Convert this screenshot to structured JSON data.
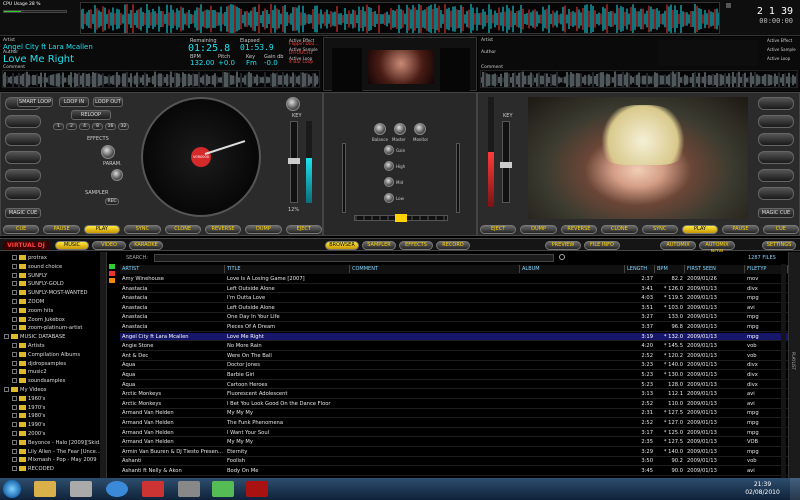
{
  "topbar": {
    "cpu_label": "CPU Usage",
    "cpu_value": "28 %",
    "clock_time": "2 1 39",
    "clock_counter": "00:00:00"
  },
  "deck_a": {
    "artist_label": "Artist",
    "artist": "Angel City ft Lara Mcallen",
    "author_label": "Author",
    "title": "Love Me Right",
    "comment_label": "Comment",
    "remaining_label": "Remaining",
    "remaining": "01:25.8",
    "elapsed_label": "Elapsed",
    "elapsed": "01:53.9",
    "bpm_label": "BPM",
    "bpm": "132.00",
    "pitch_label": "Pitch",
    "pitch": "+0.0",
    "key_label": "Key",
    "key": "Fm",
    "gain_label": "Gain db",
    "gain": "-0.0",
    "effect_label": "Active Effect",
    "effect": "Flippin Dou...",
    "sample_label": "Active Sample",
    "sample": "DITOUCH1",
    "loop_label": "Active Loop",
    "loop": "4 Bar Loop",
    "buttons": {
      "smart_loop": "SMART LOOP",
      "loop_in": "LOOP IN",
      "loop_out": "LOOP OUT",
      "reloop": "RELOOP",
      "effects": "EFFECTS",
      "param": "PARAM.",
      "sampler": "SAMPLER",
      "rec": "REC",
      "magic_cue": "MAGIC CUE",
      "key": "KEY",
      "pitch_pct": "12%"
    },
    "loop_sizes": [
      "1",
      "2",
      "4",
      "8",
      "16",
      "32"
    ],
    "transport": [
      "CUE",
      "PAUSE",
      "PLAY",
      "SYNC",
      "CLONE",
      "REVERSE",
      "DUMP",
      "EJECT"
    ],
    "platter_label": "V0R0000"
  },
  "deck_b": {
    "artist_label": "Artist",
    "author_label": "Author",
    "comment_label": "Comment",
    "effect_label": "Active Effect",
    "sample_label": "Active Sample",
    "loop_label": "Active Loop",
    "key_label": "KEY",
    "magic_cue": "MAGIC CUE",
    "transport": [
      "EJECT",
      "DUMP",
      "REVERSE",
      "CLONE",
      "SYNC",
      "PLAY",
      "PAUSE",
      "CUE"
    ]
  },
  "mixer": {
    "knobs": [
      "Balance",
      "Master",
      "Monitor"
    ],
    "eq": [
      "Gain",
      "High",
      "Mid",
      "Low"
    ]
  },
  "tabs": {
    "logo": "VIRTUAL DJ",
    "left": [
      "MUSIC",
      "VIDEO",
      "KARAOKE"
    ],
    "center": [
      "BROWSER",
      "SAMPLER",
      "EFFECTS",
      "RECORD"
    ],
    "right": [
      "PREVIEW",
      "FILE INFO"
    ],
    "far_right": [
      "AUTOMIX",
      "AUTOMIX NOW"
    ],
    "settings": "SETTINGS"
  },
  "search": {
    "label": "SEARCH:",
    "value": "",
    "files_count": "1287 FILES"
  },
  "sidebar": {
    "items": [
      {
        "label": "protrax",
        "indent": 1
      },
      {
        "label": "sound choice",
        "indent": 1
      },
      {
        "label": "SUNFLY",
        "indent": 1
      },
      {
        "label": "SUNFLY-GOLD",
        "indent": 1
      },
      {
        "label": "SUNFLY-MOST-WANTED",
        "indent": 1
      },
      {
        "label": "ZOOM",
        "indent": 1
      },
      {
        "label": "zoom hits",
        "indent": 1
      },
      {
        "label": "Zoom Jukebox",
        "indent": 1
      },
      {
        "label": "zoom-platinum-artist",
        "indent": 1
      },
      {
        "label": "MUSIC DATABASE",
        "indent": 0
      },
      {
        "label": "Artists",
        "indent": 1
      },
      {
        "label": "Compilation Albums",
        "indent": 1
      },
      {
        "label": "djdropsamples",
        "indent": 1
      },
      {
        "label": "music2",
        "indent": 1
      },
      {
        "label": "soundsamples",
        "indent": 1
      },
      {
        "label": "My Videos",
        "indent": 0
      },
      {
        "label": "1960's",
        "indent": 1
      },
      {
        "label": "1970's",
        "indent": 1
      },
      {
        "label": "1980's",
        "indent": 1
      },
      {
        "label": "1990's",
        "indent": 1
      },
      {
        "label": "2000's",
        "indent": 1
      },
      {
        "label": "Beyonce - Halo [2009][Skid...",
        "indent": 1
      },
      {
        "label": "Lily Allen - The Fear [Unce...",
        "indent": 1
      },
      {
        "label": "Mixmash - Pop - May 2009",
        "indent": 1
      },
      {
        "label": "RECODED",
        "indent": 1
      }
    ]
  },
  "table": {
    "columns": [
      "ARTIST",
      "TITLE",
      "COMMENT",
      "ALBUM",
      "LENGTH",
      "BPM",
      "FIRST SEEN",
      "FILETYP"
    ],
    "rows": [
      [
        "Amy Winehouse",
        "Love Is A Losing Game [2007]",
        "",
        "",
        "2:37",
        "82.2",
        "2009/01/26",
        "mov"
      ],
      [
        "Anastacia",
        "Left Outside Alone",
        "",
        "",
        "3:41",
        "* 126.0",
        "2009/01/13",
        "divx"
      ],
      [
        "Anastacia",
        "I'm Outta Love",
        "",
        "",
        "4:03",
        "* 119.5",
        "2009/01/13",
        "mpg"
      ],
      [
        "Anastacia",
        "Left Outside Alone",
        "",
        "",
        "3:51",
        "* 103.0",
        "2009/01/13",
        "avi"
      ],
      [
        "Anastacia",
        "One Day In Your Life",
        "",
        "",
        "3:27",
        "133.0",
        "2009/01/13",
        "mpg"
      ],
      [
        "Anastacia",
        "Pieces Of A Dream",
        "",
        "",
        "3:37",
        "96.8",
        "2009/01/13",
        "mpg"
      ],
      [
        "Angel City ft Lara Mcallen",
        "Love Me Right",
        "",
        "",
        "3:19",
        "* 132.0",
        "2009/01/13",
        "mpg"
      ],
      [
        "Angie Stone",
        "No More Rain",
        "",
        "",
        "4:20",
        "* 145.5",
        "2009/01/13",
        "vob"
      ],
      [
        "Ant & Dec",
        "Were On The Ball",
        "",
        "",
        "2:52",
        "* 120.2",
        "2009/01/13",
        "vob"
      ],
      [
        "Aqua",
        "Doctor Jones",
        "",
        "",
        "3:23",
        "* 140.0",
        "2009/01/13",
        "divx"
      ],
      [
        "Aqua",
        "Barbie Girl",
        "",
        "",
        "5:23",
        "* 130.0",
        "2009/01/13",
        "divx"
      ],
      [
        "Aqua",
        "Cartoon Heroes",
        "",
        "",
        "5:23",
        "128.0",
        "2009/01/13",
        "divx"
      ],
      [
        "Arctic Monkeys",
        "Fluorescent Adolescent",
        "",
        "",
        "3:13",
        "112.1",
        "2009/01/13",
        "avi"
      ],
      [
        "Arctic Monkeys",
        "I Bet You Look Good On the Dance Floor",
        "",
        "",
        "2:52",
        "110.0",
        "2009/01/13",
        "avi"
      ],
      [
        "Armand Van Helden",
        "My My My",
        "",
        "",
        "2:31",
        "* 127.5",
        "2009/01/13",
        "mpg"
      ],
      [
        "Armand Van Helden",
        "The Funk Phenomena",
        "",
        "",
        "2:52",
        "* 127.0",
        "2009/01/13",
        "mpg"
      ],
      [
        "Armand Van Helden",
        "I Want Your Soul",
        "",
        "",
        "3:17",
        "* 125.0",
        "2009/01/13",
        "mpg"
      ],
      [
        "Armand Van Helden",
        "My My My",
        "",
        "",
        "2:35",
        "* 127.5",
        "2009/01/13",
        "VOB"
      ],
      [
        "Armin Van Buuren & DJ Tiesto Presen...",
        "Eternity",
        "",
        "",
        "3:29",
        "* 140.0",
        "2009/01/13",
        "mpg"
      ],
      [
        "Ashanti",
        "Foolish",
        "",
        "",
        "3:50",
        "90.2",
        "2009/01/13",
        "vob"
      ],
      [
        "Ashanti ft Nelly & Akon",
        "Body On Me",
        "",
        "",
        "3:45",
        "90.0",
        "2009/01/13",
        "avi"
      ]
    ]
  },
  "right_strip_label": "PLAYLIST",
  "taskbar": {
    "time": "21:39",
    "date": "02/08/2010"
  },
  "colors": {
    "cyan": "#1ee3f0",
    "red": "#ff3b3b",
    "yellow": "#ffd200",
    "selection": "#16166a"
  }
}
